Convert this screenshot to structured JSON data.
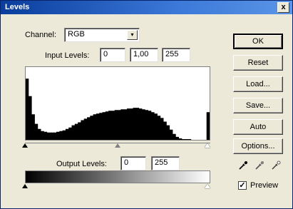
{
  "window": {
    "title": "Levels",
    "close_glyph": "x"
  },
  "channel": {
    "label": "Channel:",
    "value": "RGB",
    "arrow": "▾"
  },
  "input_levels": {
    "label": "Input Levels:",
    "black": "0",
    "gamma": "1,00",
    "white": "255"
  },
  "output_levels": {
    "label": "Output Levels:",
    "black": "0",
    "white": "255"
  },
  "buttons": {
    "ok": "OK",
    "reset": "Reset",
    "load": "Load...",
    "save": "Save...",
    "auto": "Auto",
    "options": "Options..."
  },
  "preview": {
    "label": "Preview",
    "checked": true,
    "check_glyph": "✓"
  },
  "icons": {
    "eyedroppers": [
      "black-eyedropper-icon",
      "gray-eyedropper-icon",
      "white-eyedropper-icon"
    ]
  },
  "histogram": {
    "levels": [
      0.84,
      0.6,
      0.35,
      0.22,
      0.15,
      0.12,
      0.11,
      0.1,
      0.1,
      0.1,
      0.11,
      0.12,
      0.13,
      0.15,
      0.17,
      0.2,
      0.22,
      0.24,
      0.27,
      0.29,
      0.31,
      0.33,
      0.35,
      0.36,
      0.37,
      0.38,
      0.39,
      0.4,
      0.4,
      0.41,
      0.41,
      0.42,
      0.42,
      0.43,
      0.43,
      0.44,
      0.44,
      0.43,
      0.42,
      0.41,
      0.4,
      0.38,
      0.36,
      0.33,
      0.3,
      0.25,
      0.2,
      0.14,
      0.08,
      0.04,
      0.02,
      0.01,
      0.01,
      0.01,
      0.0,
      0.0,
      0.0,
      0.0,
      0.0,
      0.38
    ]
  }
}
